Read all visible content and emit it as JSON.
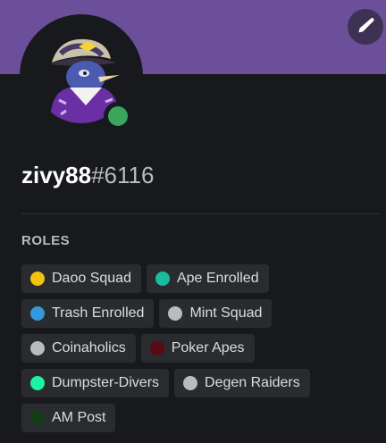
{
  "profile": {
    "username": "zivy88",
    "discriminator": "#6116",
    "banner_color": "#6b4f9a",
    "status": "online",
    "status_color": "#3ba55d",
    "edit_icon": "pencil-icon"
  },
  "roles_section": {
    "title": "ROLES",
    "roles": [
      {
        "name": "Daoo Squad",
        "color": "#f1c40f"
      },
      {
        "name": "Ape Enrolled",
        "color": "#1abc9c"
      },
      {
        "name": "Trash Enrolled",
        "color": "#3498db"
      },
      {
        "name": "Mint Squad",
        "color": "#b9bbbe"
      },
      {
        "name": "Coinaholics",
        "color": "#b9bbbe"
      },
      {
        "name": "Poker Apes",
        "color": "#5a0a14"
      },
      {
        "name": "Dumpster-Divers",
        "color": "#1df2a1"
      },
      {
        "name": "Degen Raiders",
        "color": "#b9bbbe"
      },
      {
        "name": "AM Post",
        "color": "#123d16"
      }
    ]
  }
}
